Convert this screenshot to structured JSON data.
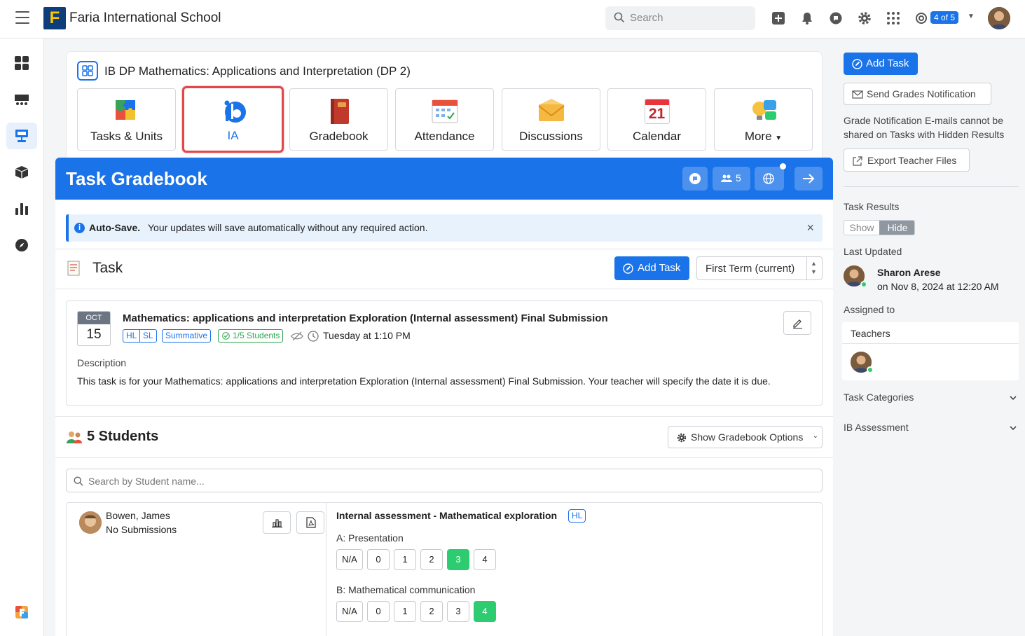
{
  "topbar": {
    "logo_letter": "F",
    "school_name": "Faria International School",
    "search_placeholder": "Search",
    "pager_label": "4 of 5"
  },
  "class_card": {
    "title": "IB DP Mathematics: Applications and Interpretation (DP 2)",
    "tiles": [
      {
        "label": "Tasks & Units"
      },
      {
        "label": "IA"
      },
      {
        "label": "Gradebook"
      },
      {
        "label": "Attendance"
      },
      {
        "label": "Discussions"
      },
      {
        "label": "Calendar"
      },
      {
        "label": "More"
      }
    ],
    "calendar_day": "21",
    "gradebook_tag": "GB"
  },
  "gradebook": {
    "title": "Task Gradebook",
    "members_count": "5",
    "notice_bold": "Auto-Save.",
    "notice_text": "Your updates will save automatically without any required action.",
    "close_glyph": "×"
  },
  "task_section": {
    "title": "Task",
    "add_task_label": "Add Task",
    "term_select": "First Term (current)",
    "date_month": "OCT",
    "date_day": "15",
    "task_title": "Mathematics: applications and interpretation Exploration (Internal assessment) Final Submission",
    "chips": [
      "HL",
      "SL",
      "Summative",
      "1/5 Students"
    ],
    "due_time": "Tuesday at 1:10 PM",
    "description_label": "Description",
    "description_text": "This task is for your Mathematics: applications and interpretation Exploration (Internal assessment) Final Submission. Your teacher will specify the date it is due."
  },
  "students_section": {
    "title": "5 Students",
    "options_label": "Show Gradebook Options",
    "search_placeholder": "Search by Student name...",
    "student": {
      "name": "Bowen, James",
      "status": "No Submissions",
      "assessment_title": "Internal assessment - Mathematical exploration",
      "assessment_level": "HL",
      "criteria": [
        {
          "label": "A: Presentation",
          "options": [
            "N/A",
            "0",
            "1",
            "2",
            "3",
            "4"
          ],
          "selected": "3"
        },
        {
          "label": "B: Mathematical communication",
          "options": [
            "N/A",
            "0",
            "1",
            "2",
            "3",
            "4"
          ],
          "selected": "4"
        }
      ]
    }
  },
  "sidebar": {
    "add_task_label": "Add Task",
    "send_grades_label": "Send Grades Notification",
    "grade_note": "Grade Notification E-mails cannot be shared on Tasks with Hidden Results",
    "export_label": "Export Teacher Files",
    "task_results_label": "Task Results",
    "toggle_show": "Show",
    "toggle_hide": "Hide",
    "last_updated_label": "Last Updated",
    "updated_by": "Sharon Arese",
    "updated_on": "on Nov 8, 2024 at 12:20 AM",
    "assigned_to_label": "Assigned to",
    "teachers_label": "Teachers",
    "task_categories_label": "Task Categories",
    "ib_assessment_label": "IB Assessment"
  },
  "colors": {
    "primary": "#1a73e8",
    "selected_grade": "#2ecc71",
    "highlight_border": "#e0484a"
  }
}
